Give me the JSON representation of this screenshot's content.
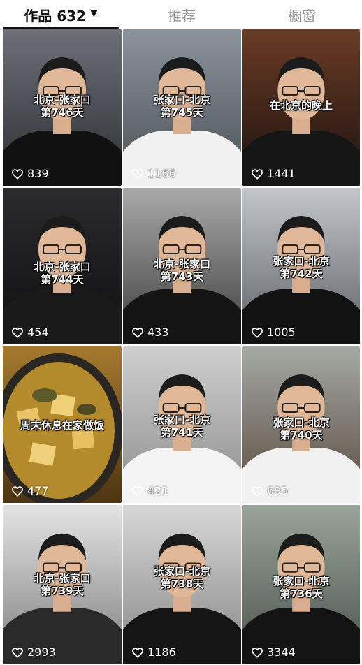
{
  "tabs": [
    {
      "label": "作品 632",
      "active": true
    },
    {
      "label": "推荐",
      "active": false
    },
    {
      "label": "橱窗",
      "active": false
    }
  ],
  "videos": [
    {
      "caption": [
        "北京-张家口",
        "第746天"
      ],
      "likes": "839",
      "bg": [
        "#6d7076",
        "#2b2e33"
      ],
      "shirt": "#111111",
      "captionTop": 92
    },
    {
      "caption": [
        "张家口-北京",
        "第745天"
      ],
      "likes": "1166",
      "bg": [
        "#8a949a",
        "#4a5157"
      ],
      "shirt": "#f1f1f1",
      "captionTop": 92
    },
    {
      "caption": [
        "在北京的晚上"
      ],
      "likes": "1441",
      "bg": [
        "#6b3b24",
        "#1a1210"
      ],
      "shirt": "#151515",
      "captionTop": 100
    },
    {
      "caption": [
        "北京-张家口",
        "第744天"
      ],
      "likes": "454",
      "bg": [
        "#2b2b2e",
        "#0f0f10"
      ],
      "shirt": "#1a1a1a",
      "captionTop": 104
    },
    {
      "caption": [
        "北京-张家口",
        "第743天"
      ],
      "likes": "433",
      "bg": [
        "#a9a9a9",
        "#3d3d3e"
      ],
      "shirt": "#141414",
      "captionTop": 100
    },
    {
      "caption": [
        "张家口-北京",
        "第742天"
      ],
      "likes": "1005",
      "bg": [
        "#c3c7cb",
        "#5d6167"
      ],
      "shirt": "#121212",
      "captionTop": 96
    },
    {
      "caption": [
        "周末休息在家做饭"
      ],
      "likes": "477",
      "bg": [
        "#a57a2e",
        "#4d3512"
      ],
      "shirt": "#d4a640",
      "captionTop": 104
    },
    {
      "caption": [
        "张家口-北京",
        "第741天"
      ],
      "likes": "421",
      "bg": [
        "#cfcfcf",
        "#8d8d8d"
      ],
      "shirt": "#f4f4f4",
      "captionTop": 96
    },
    {
      "caption": [
        "张家口-北京",
        "第740天"
      ],
      "likes": "695",
      "bg": [
        "#a4a9a4",
        "#5a4a3c"
      ],
      "shirt": "#f1f1f1",
      "captionTop": 100
    },
    {
      "caption": [
        "北京-张家口",
        "第739天"
      ],
      "likes": "2993",
      "bg": [
        "#e4e4e4",
        "#7e7e80"
      ],
      "shirt": "#2a2a2a",
      "captionTop": 96
    },
    {
      "caption": [
        "张家口-北京",
        "第738天"
      ],
      "likes": "1186",
      "bg": [
        "#d7d7d7",
        "#878787"
      ],
      "shirt": "#151515",
      "captionTop": 86
    },
    {
      "caption": [
        "张家口-北京",
        "第736天"
      ],
      "likes": "3344",
      "bg": [
        "#99a59a",
        "#49524c"
      ],
      "shirt": "#141414",
      "captionTop": 100
    }
  ],
  "icons": {
    "like": "heart-outline-icon",
    "caret": "caret-down-icon"
  }
}
